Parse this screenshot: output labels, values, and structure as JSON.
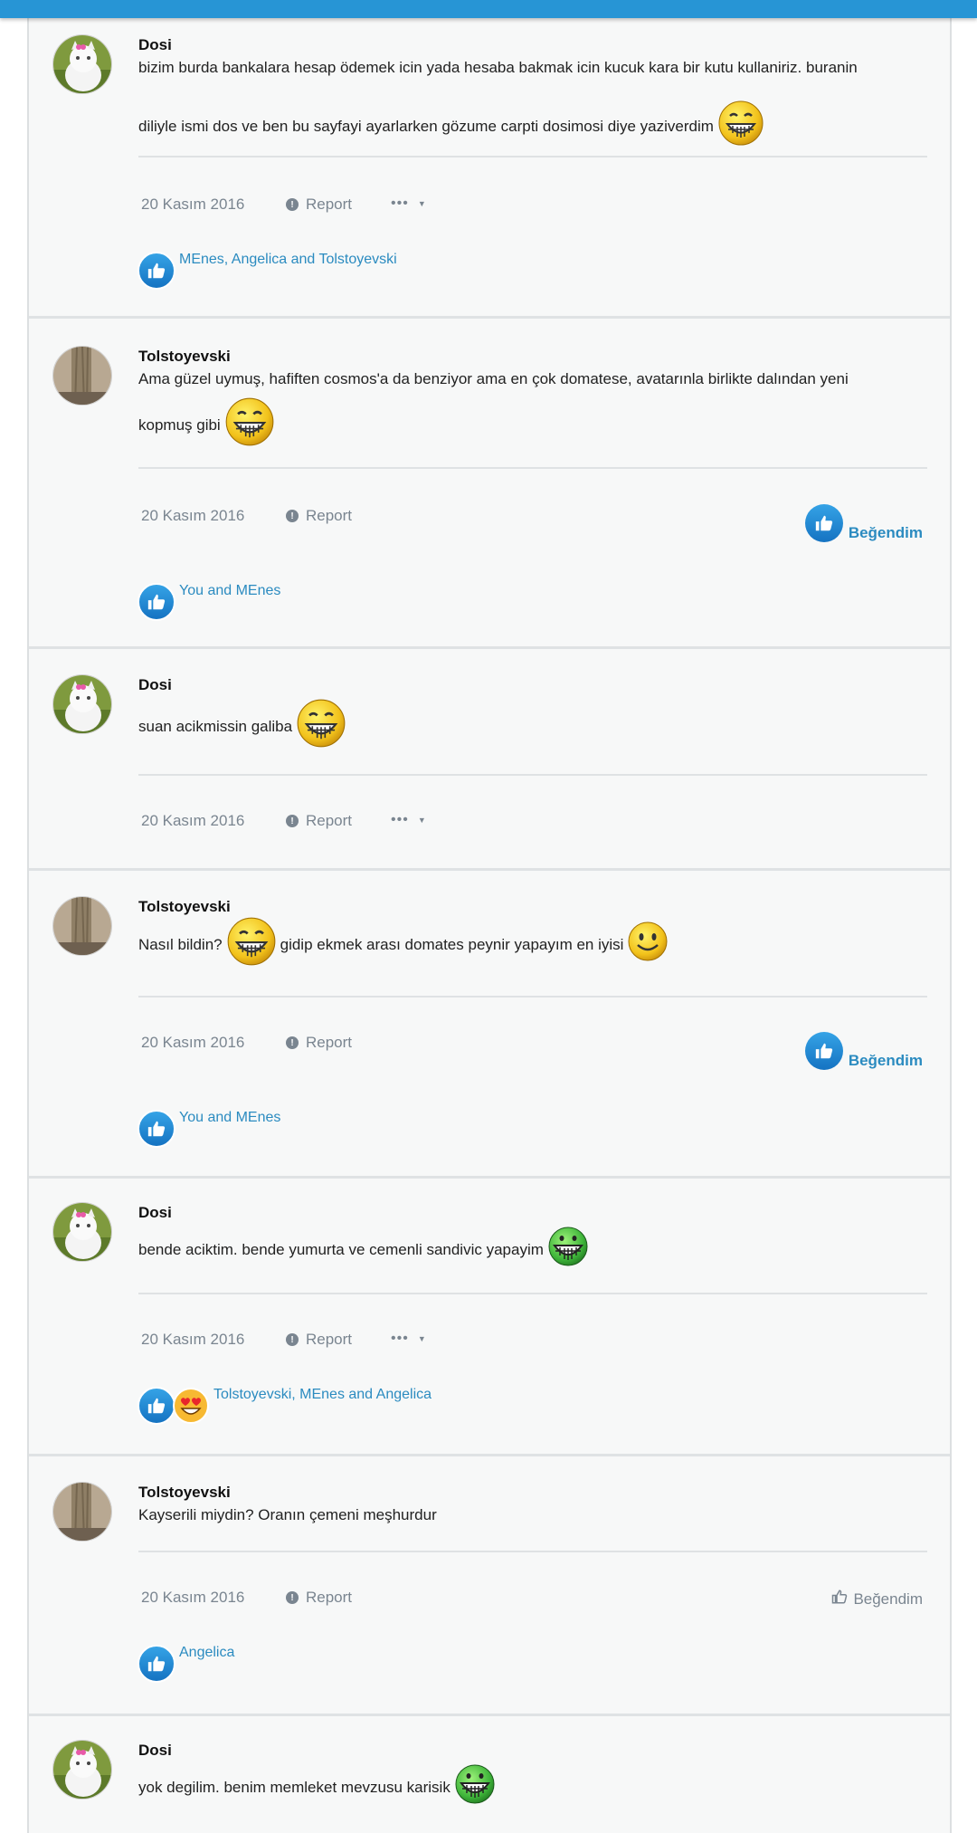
{
  "report_label": "Report",
  "more_label": "•••",
  "like_label": "Beğendim",
  "posts": [
    {
      "author": "Dosi",
      "avatar": "cat-avatar",
      "text": [
        "bizim burda bankalara hesap ödemek icin yada hesaba bakmak icin kucuk kara bir kutu kullaniriz. buranin",
        "diliyle ismi dos ve ben bu sayfayi ayarlarken gözume carpti dosimosi diye yaziverdim"
      ],
      "date": "20 Kasım 2016",
      "reactions": "MEnes, Angelica and Tolstoyevski"
    },
    {
      "author": "Tolstoyevski",
      "avatar": "tree-avatar",
      "text": [
        "Ama güzel uymuş, hafiften cosmos'a da benziyor ama en çok domatese, avatarınla birlikte dalından yeni",
        "kopmuş gibi"
      ],
      "date": "20 Kasım 2016",
      "reactions": "You and MEnes"
    },
    {
      "author": "Dosi",
      "avatar": "cat-avatar",
      "text": [
        "suan acikmissin galiba"
      ],
      "date": "20 Kasım 2016"
    },
    {
      "author": "Tolstoyevski",
      "avatar": "tree-avatar",
      "text": [
        "Nasıl bildin?",
        "gidip ekmek arası domates peynir yapayım en iyisi"
      ],
      "date": "20 Kasım 2016",
      "reactions": "You and MEnes"
    },
    {
      "author": "Dosi",
      "avatar": "cat-avatar",
      "text": [
        "bende aciktim. bende yumurta ve cemenli sandivic yapayim"
      ],
      "date": "20 Kasım 2016",
      "reactions": "Tolstoyevski, MEnes and Angelica"
    },
    {
      "author": "Tolstoyevski",
      "avatar": "tree-avatar",
      "text": [
        "Kayserili miydin? Oranın çemeni meşhurdur"
      ],
      "date": "20 Kasım 2016",
      "reactions": "Angelica"
    },
    {
      "author": "Dosi",
      "avatar": "cat-avatar",
      "text": [
        "yok degilim. benim memleket mevzusu karisik"
      ]
    }
  ]
}
